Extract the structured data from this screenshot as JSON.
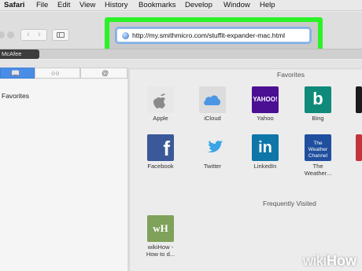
{
  "menu": [
    "Safari",
    "File",
    "Edit",
    "View",
    "History",
    "Bookmarks",
    "Develop",
    "Window",
    "Help"
  ],
  "toolbar": {
    "url": "http://my.smithmicro.com/stuffit-expander-mac.html"
  },
  "tabs": {
    "active": "McAfee"
  },
  "sidebar": {
    "title": "Favorites",
    "segments": [
      "book-icon",
      "reading-list-icon",
      "shared-links-icon"
    ]
  },
  "favorites": {
    "heading": "Favorites",
    "items": [
      {
        "label": "Apple",
        "icon": "apple-icon"
      },
      {
        "label": "iCloud",
        "icon": "cloud-icon"
      },
      {
        "label": "Yahoo",
        "icon": "yahoo-icon",
        "text": "YAHOO!"
      },
      {
        "label": "Bing",
        "icon": "bing-icon",
        "text": "b"
      },
      {
        "label": "Facebook",
        "icon": "facebook-icon",
        "text": "f"
      },
      {
        "label": "Twitter",
        "icon": "twitter-bird-icon"
      },
      {
        "label": "LinkedIn",
        "icon": "linkedin-icon",
        "text": "in"
      },
      {
        "label1": "The",
        "label2": "Weather...",
        "icon": "weather-channel-icon",
        "text": "The Weather Channel"
      }
    ]
  },
  "frequently_visited": {
    "heading": "Frequently Visited",
    "items": [
      {
        "label1": "wikiHow -",
        "label2": "How to d...",
        "icon": "wikihow-icon",
        "text": "wH"
      }
    ]
  },
  "watermark": {
    "prefix": "wiki",
    "suffix": "How"
  },
  "colors": {
    "highlight": "#2bf227",
    "selected": "#4a8de6",
    "yahoo": "#4b0f93",
    "bing": "#0f8a7a",
    "facebook": "#3b5998",
    "linkedin": "#0e76a8",
    "weather": "#1f4f9e",
    "wikihow": "#7fa15a"
  }
}
